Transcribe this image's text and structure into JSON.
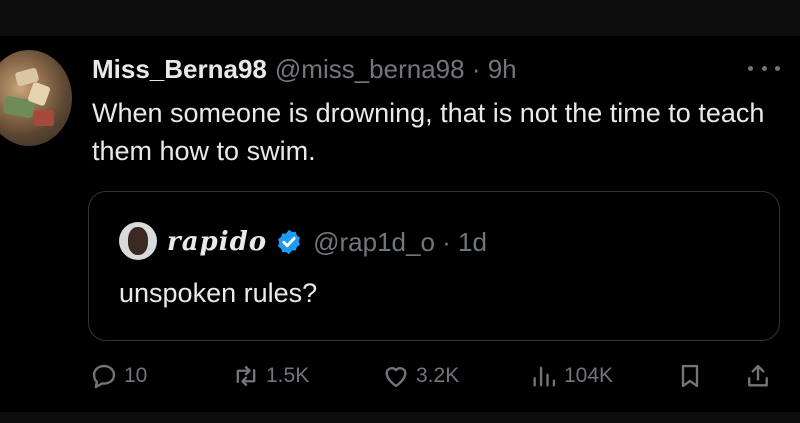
{
  "tweet": {
    "display_name": "Miss_Berna98",
    "handle_time": "@miss_berna98 · 9h",
    "text": "When someone is drowning, that is not the time to teach them how to swim."
  },
  "quoted": {
    "display_name": "rapido",
    "handle_time": "@rap1d_o · 1d",
    "text": "unspoken rules?"
  },
  "actions": {
    "replies": "10",
    "reposts": "1.5K",
    "likes": "3.2K",
    "views": "104K"
  },
  "icons": {
    "reply": "reply-icon",
    "repost": "repost-icon",
    "like": "heart-icon",
    "views": "views-icon",
    "bookmark": "bookmark-icon",
    "share": "share-icon",
    "more": "more-icon",
    "verified": "verified-badge-icon"
  },
  "colors": {
    "background": "#000000",
    "text": "#e7e9ea",
    "muted": "#71767b",
    "verified": "#1d9bf0",
    "border": "#2f3336"
  }
}
